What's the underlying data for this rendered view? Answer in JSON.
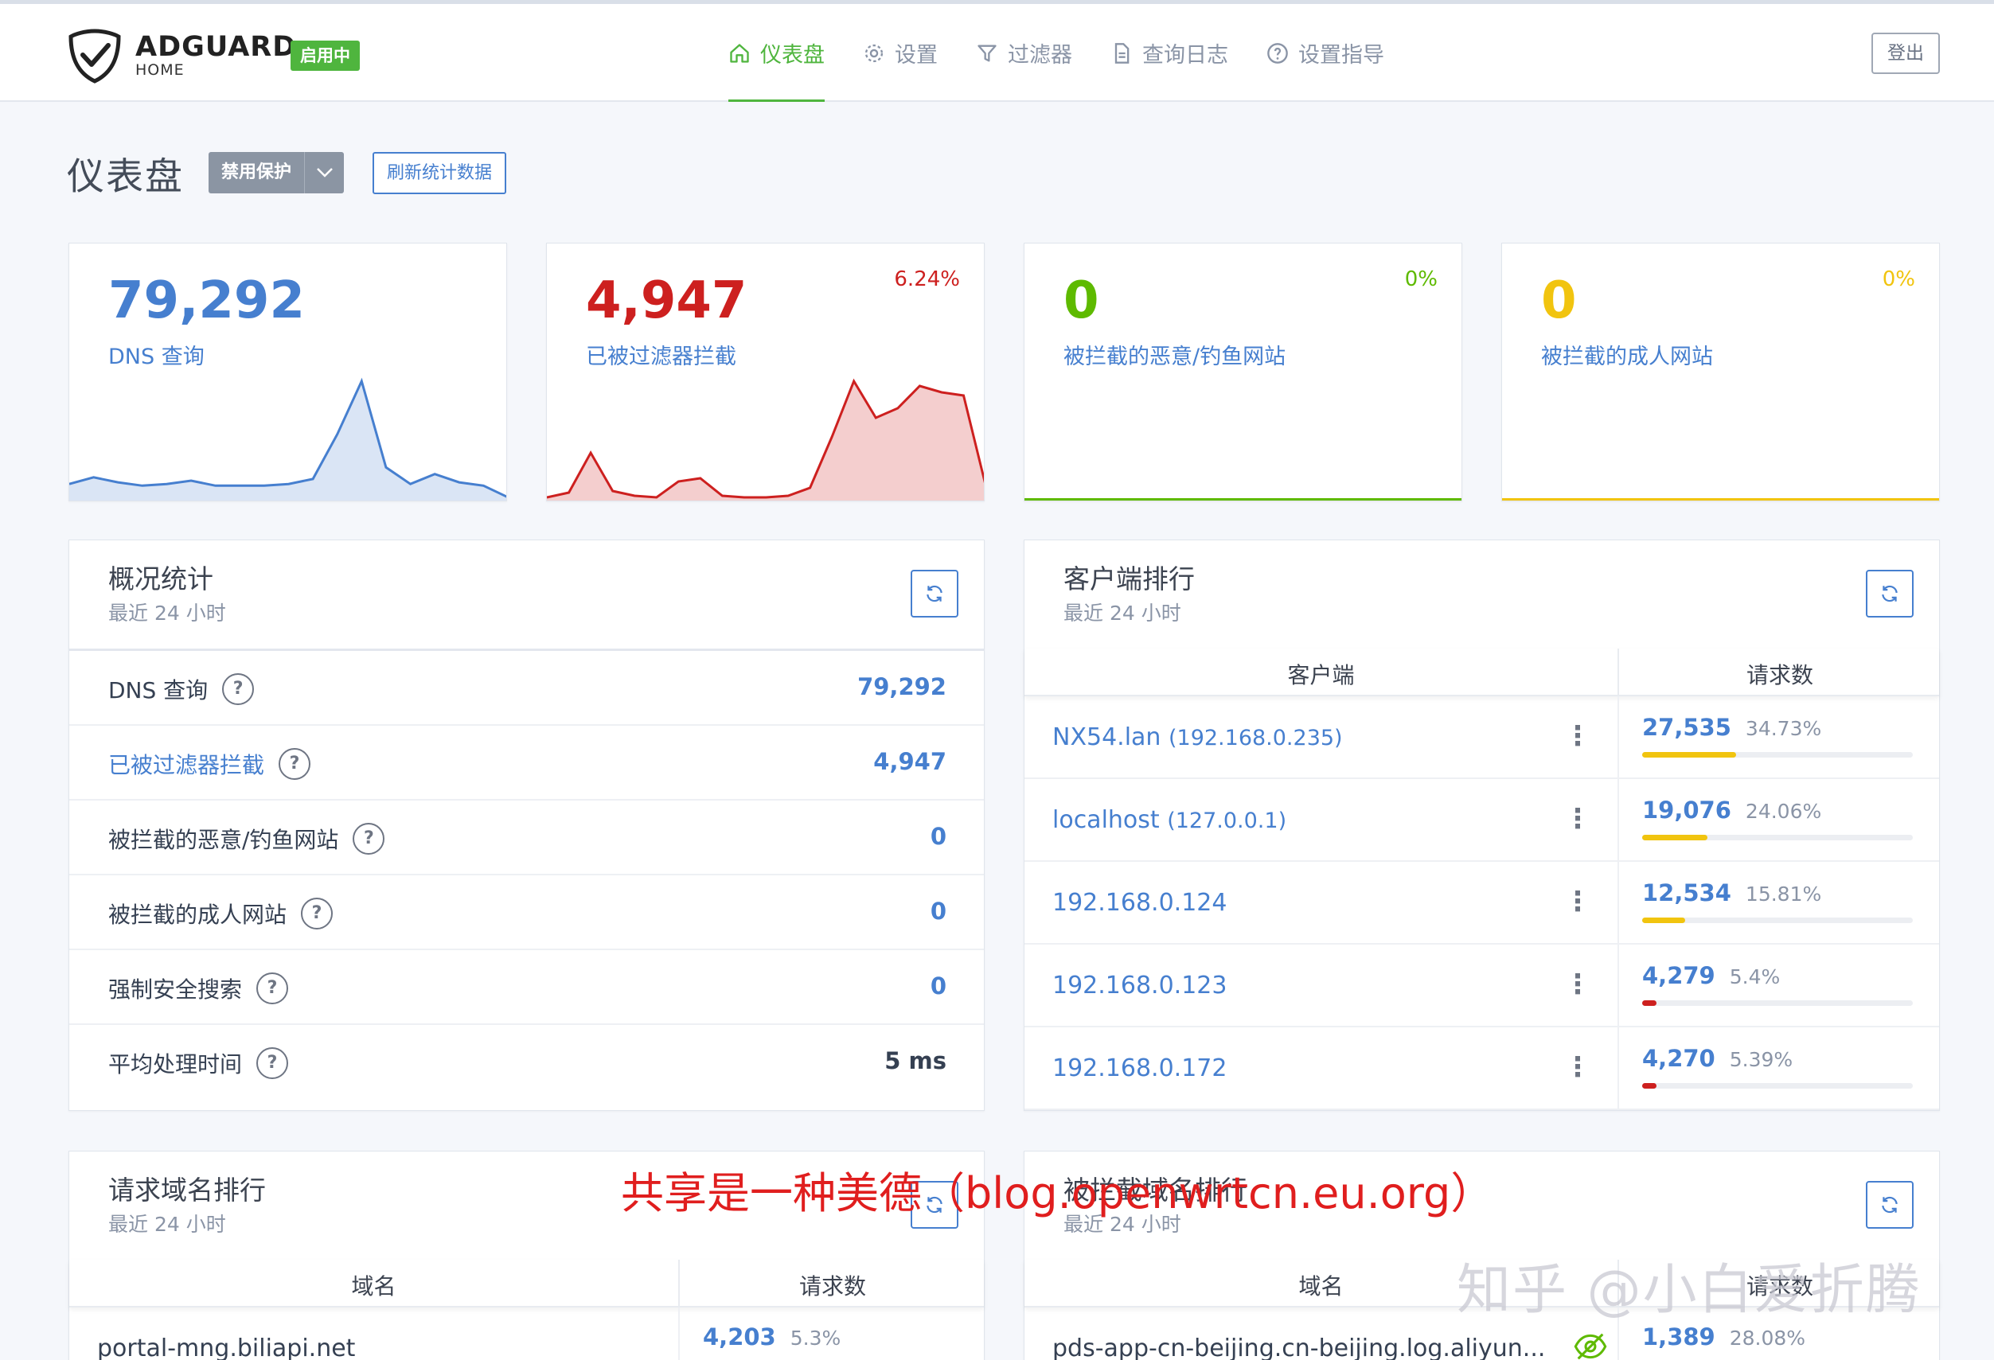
{
  "brand": {
    "name": "ADGUARD",
    "sub": "HOME",
    "status": "启用中"
  },
  "nav": {
    "items": [
      {
        "label": "仪表盘",
        "icon": "home-icon",
        "active": true
      },
      {
        "label": "设置",
        "icon": "gear-icon",
        "active": false
      },
      {
        "label": "过滤器",
        "icon": "filter-icon",
        "active": false
      },
      {
        "label": "查询日志",
        "icon": "document-icon",
        "active": false
      },
      {
        "label": "设置指导",
        "icon": "help-circle-icon",
        "active": false
      }
    ],
    "logout": "登出"
  },
  "title_row": {
    "title": "仪表盘",
    "disable": "禁用保护",
    "refresh": "刷新统计数据"
  },
  "stat_cards": [
    {
      "value": "79,292",
      "label": "DNS 查询",
      "pct": "",
      "color": "#467fcf"
    },
    {
      "value": "4,947",
      "label": "已被过滤器拦截",
      "pct": "6.24%",
      "color": "#cd201f"
    },
    {
      "value": "0",
      "label": "被拦截的恶意/钓鱼网站",
      "pct": "0%",
      "color": "#5eba00"
    },
    {
      "value": "0",
      "label": "被拦截的成人网站",
      "pct": "0%",
      "color": "#f1c40f"
    }
  ],
  "chart_data": [
    {
      "type": "area",
      "series": [
        {
          "values": [
            10,
            14,
            11,
            9,
            10,
            12,
            9,
            9,
            9,
            10,
            13,
            40,
            72,
            20,
            10,
            16,
            11,
            9,
            2
          ]
        }
      ]
    },
    {
      "type": "area",
      "series": [
        {
          "values": [
            2,
            5,
            30,
            6,
            3,
            2,
            12,
            14,
            3,
            2,
            2,
            3,
            8,
            40,
            75,
            52,
            58,
            72,
            68,
            66,
            10
          ]
        }
      ]
    }
  ],
  "general": {
    "title": "概况统计",
    "sub": "最近 24 小时",
    "rows": [
      {
        "label": "DNS 查询",
        "value": "79,292"
      },
      {
        "label": "已被过滤器拦截",
        "value": "4,947"
      },
      {
        "label": "被拦截的恶意/钓鱼网站",
        "value": "0"
      },
      {
        "label": "被拦截的成人网站",
        "value": "0"
      },
      {
        "label": "强制安全搜索",
        "value": "0"
      },
      {
        "label": "平均处理时间",
        "value": "5 ms"
      }
    ]
  },
  "clients": {
    "title": "客户端排行",
    "sub": "最近 24 小时",
    "col_client": "客户端",
    "col_requests": "请求数",
    "rows": [
      {
        "name": "NX54.lan",
        "ip": "(192.168.0.235)",
        "count": "27,535",
        "pct": "34.73%",
        "share": 34.73,
        "color": "#f1c40f"
      },
      {
        "name": "localhost",
        "ip": "(127.0.0.1)",
        "count": "19,076",
        "pct": "24.06%",
        "share": 24.06,
        "color": "#f1c40f"
      },
      {
        "name": "192.168.0.124",
        "ip": "",
        "count": "12,534",
        "pct": "15.81%",
        "share": 15.81,
        "color": "#f1c40f"
      },
      {
        "name": "192.168.0.123",
        "ip": "",
        "count": "4,279",
        "pct": "5.4%",
        "share": 5.4,
        "color": "#cd201f"
      },
      {
        "name": "192.168.0.172",
        "ip": "",
        "count": "4,270",
        "pct": "5.39%",
        "share": 5.39,
        "color": "#cd201f"
      }
    ]
  },
  "top_queried": {
    "title": "请求域名排行",
    "sub": "最近 24 小时",
    "col_domain": "域名",
    "col_requests": "请求数",
    "rows": [
      {
        "domain": "portal-mng.biliapi.net",
        "count": "4,203",
        "pct": "5.3%"
      }
    ]
  },
  "top_blocked": {
    "title": "被拦截域名排行",
    "sub": "最近 24 小时",
    "col_domain": "域名",
    "col_requests": "请求数",
    "rows": [
      {
        "domain": "pds-app-cn-beijing.cn-beijing.log.aliyun...",
        "count": "1,389",
        "pct": "28.08%"
      }
    ]
  },
  "watermarks": {
    "red": "共享是一种美德（blog.openwrtcn.eu.org）",
    "zhihu": "知乎 @小白爱折腾"
  }
}
